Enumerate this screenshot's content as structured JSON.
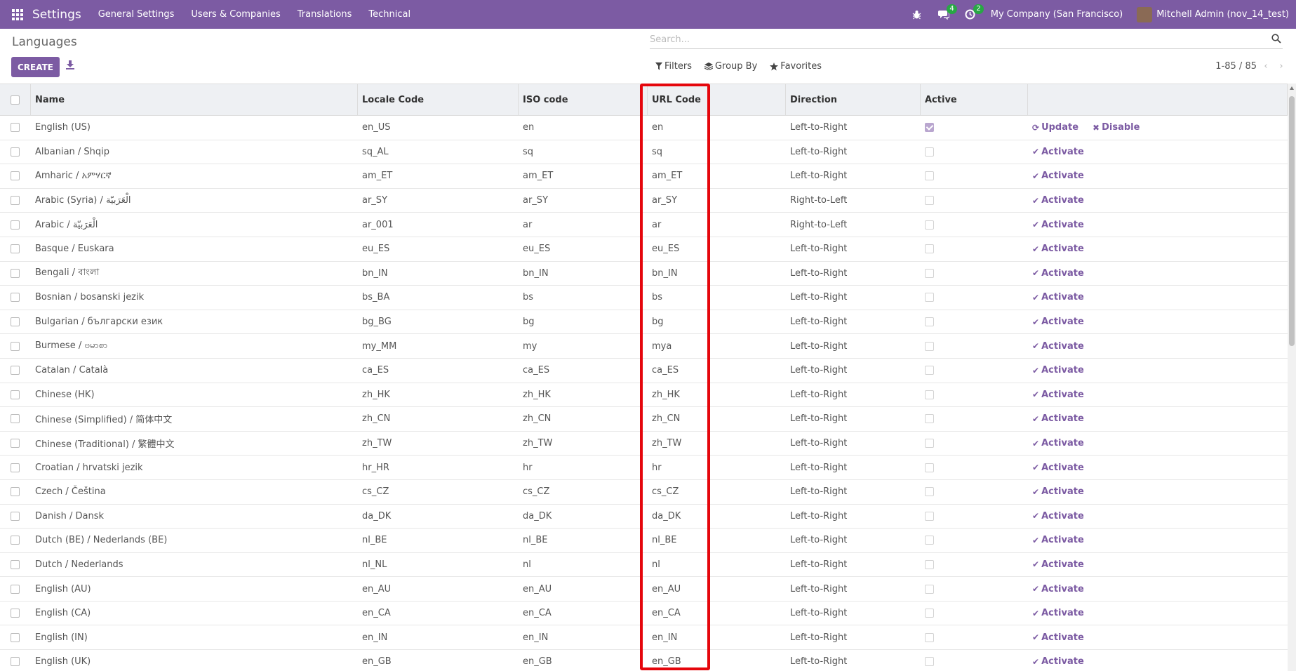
{
  "topnav": {
    "app_name": "Settings",
    "menu": [
      "General Settings",
      "Users & Companies",
      "Translations",
      "Technical"
    ],
    "messages_count": "4",
    "activities_count": "2",
    "company": "My Company (San Francisco)",
    "user": "Mitchell Admin (nov_14_test)",
    "colors": {
      "bar": "#7c5ba3",
      "badge": "#28a745"
    }
  },
  "control": {
    "breadcrumb": "Languages",
    "create_label": "CREATE",
    "search_placeholder": "Search...",
    "filters_label": "Filters",
    "groupby_label": "Group By",
    "favorites_label": "Favorites",
    "pager": "1-85 / 85"
  },
  "table": {
    "headers": [
      "Name",
      "Locale Code",
      "ISO code",
      "URL Code",
      "Direction",
      "Active"
    ],
    "rows": [
      {
        "name": "English (US)",
        "locale": "en_US",
        "iso": "en",
        "url": "en",
        "dir": "Left-to-Right",
        "active": true
      },
      {
        "name": "Albanian / Shqip",
        "locale": "sq_AL",
        "iso": "sq",
        "url": "sq",
        "dir": "Left-to-Right",
        "active": false
      },
      {
        "name": "Amharic / አምሃርኛ",
        "locale": "am_ET",
        "iso": "am_ET",
        "url": "am_ET",
        "dir": "Left-to-Right",
        "active": false
      },
      {
        "name": "Arabic (Syria) / الْعَرَبيّة",
        "locale": "ar_SY",
        "iso": "ar_SY",
        "url": "ar_SY",
        "dir": "Right-to-Left",
        "active": false
      },
      {
        "name": "Arabic / الْعَرَبيّة",
        "locale": "ar_001",
        "iso": "ar",
        "url": "ar",
        "dir": "Right-to-Left",
        "active": false
      },
      {
        "name": "Basque / Euskara",
        "locale": "eu_ES",
        "iso": "eu_ES",
        "url": "eu_ES",
        "dir": "Left-to-Right",
        "active": false
      },
      {
        "name": "Bengali / বাংলা",
        "locale": "bn_IN",
        "iso": "bn_IN",
        "url": "bn_IN",
        "dir": "Left-to-Right",
        "active": false
      },
      {
        "name": "Bosnian / bosanski jezik",
        "locale": "bs_BA",
        "iso": "bs",
        "url": "bs",
        "dir": "Left-to-Right",
        "active": false
      },
      {
        "name": "Bulgarian / български език",
        "locale": "bg_BG",
        "iso": "bg",
        "url": "bg",
        "dir": "Left-to-Right",
        "active": false
      },
      {
        "name": "Burmese / ဗမာစာ",
        "locale": "my_MM",
        "iso": "my",
        "url": "mya",
        "dir": "Left-to-Right",
        "active": false
      },
      {
        "name": "Catalan / Català",
        "locale": "ca_ES",
        "iso": "ca_ES",
        "url": "ca_ES",
        "dir": "Left-to-Right",
        "active": false
      },
      {
        "name": "Chinese (HK)",
        "locale": "zh_HK",
        "iso": "zh_HK",
        "url": "zh_HK",
        "dir": "Left-to-Right",
        "active": false
      },
      {
        "name": "Chinese (Simplified) / 简体中文",
        "locale": "zh_CN",
        "iso": "zh_CN",
        "url": "zh_CN",
        "dir": "Left-to-Right",
        "active": false
      },
      {
        "name": "Chinese (Traditional) / 繁體中文",
        "locale": "zh_TW",
        "iso": "zh_TW",
        "url": "zh_TW",
        "dir": "Left-to-Right",
        "active": false
      },
      {
        "name": "Croatian / hrvatski jezik",
        "locale": "hr_HR",
        "iso": "hr",
        "url": "hr",
        "dir": "Left-to-Right",
        "active": false
      },
      {
        "name": "Czech / Čeština",
        "locale": "cs_CZ",
        "iso": "cs_CZ",
        "url": "cs_CZ",
        "dir": "Left-to-Right",
        "active": false
      },
      {
        "name": "Danish / Dansk",
        "locale": "da_DK",
        "iso": "da_DK",
        "url": "da_DK",
        "dir": "Left-to-Right",
        "active": false
      },
      {
        "name": "Dutch (BE) / Nederlands (BE)",
        "locale": "nl_BE",
        "iso": "nl_BE",
        "url": "nl_BE",
        "dir": "Left-to-Right",
        "active": false
      },
      {
        "name": "Dutch / Nederlands",
        "locale": "nl_NL",
        "iso": "nl",
        "url": "nl",
        "dir": "Left-to-Right",
        "active": false
      },
      {
        "name": "English (AU)",
        "locale": "en_AU",
        "iso": "en_AU",
        "url": "en_AU",
        "dir": "Left-to-Right",
        "active": false
      },
      {
        "name": "English (CA)",
        "locale": "en_CA",
        "iso": "en_CA",
        "url": "en_CA",
        "dir": "Left-to-Right",
        "active": false
      },
      {
        "name": "English (IN)",
        "locale": "en_IN",
        "iso": "en_IN",
        "url": "en_IN",
        "dir": "Left-to-Right",
        "active": false
      },
      {
        "name": "English (UK)",
        "locale": "en_GB",
        "iso": "en_GB",
        "url": "en_GB",
        "dir": "Left-to-Right",
        "active": false
      }
    ],
    "actions": {
      "update": "Update",
      "disable": "Disable",
      "activate": "Activate"
    },
    "highlight_color": "#e5060c"
  }
}
